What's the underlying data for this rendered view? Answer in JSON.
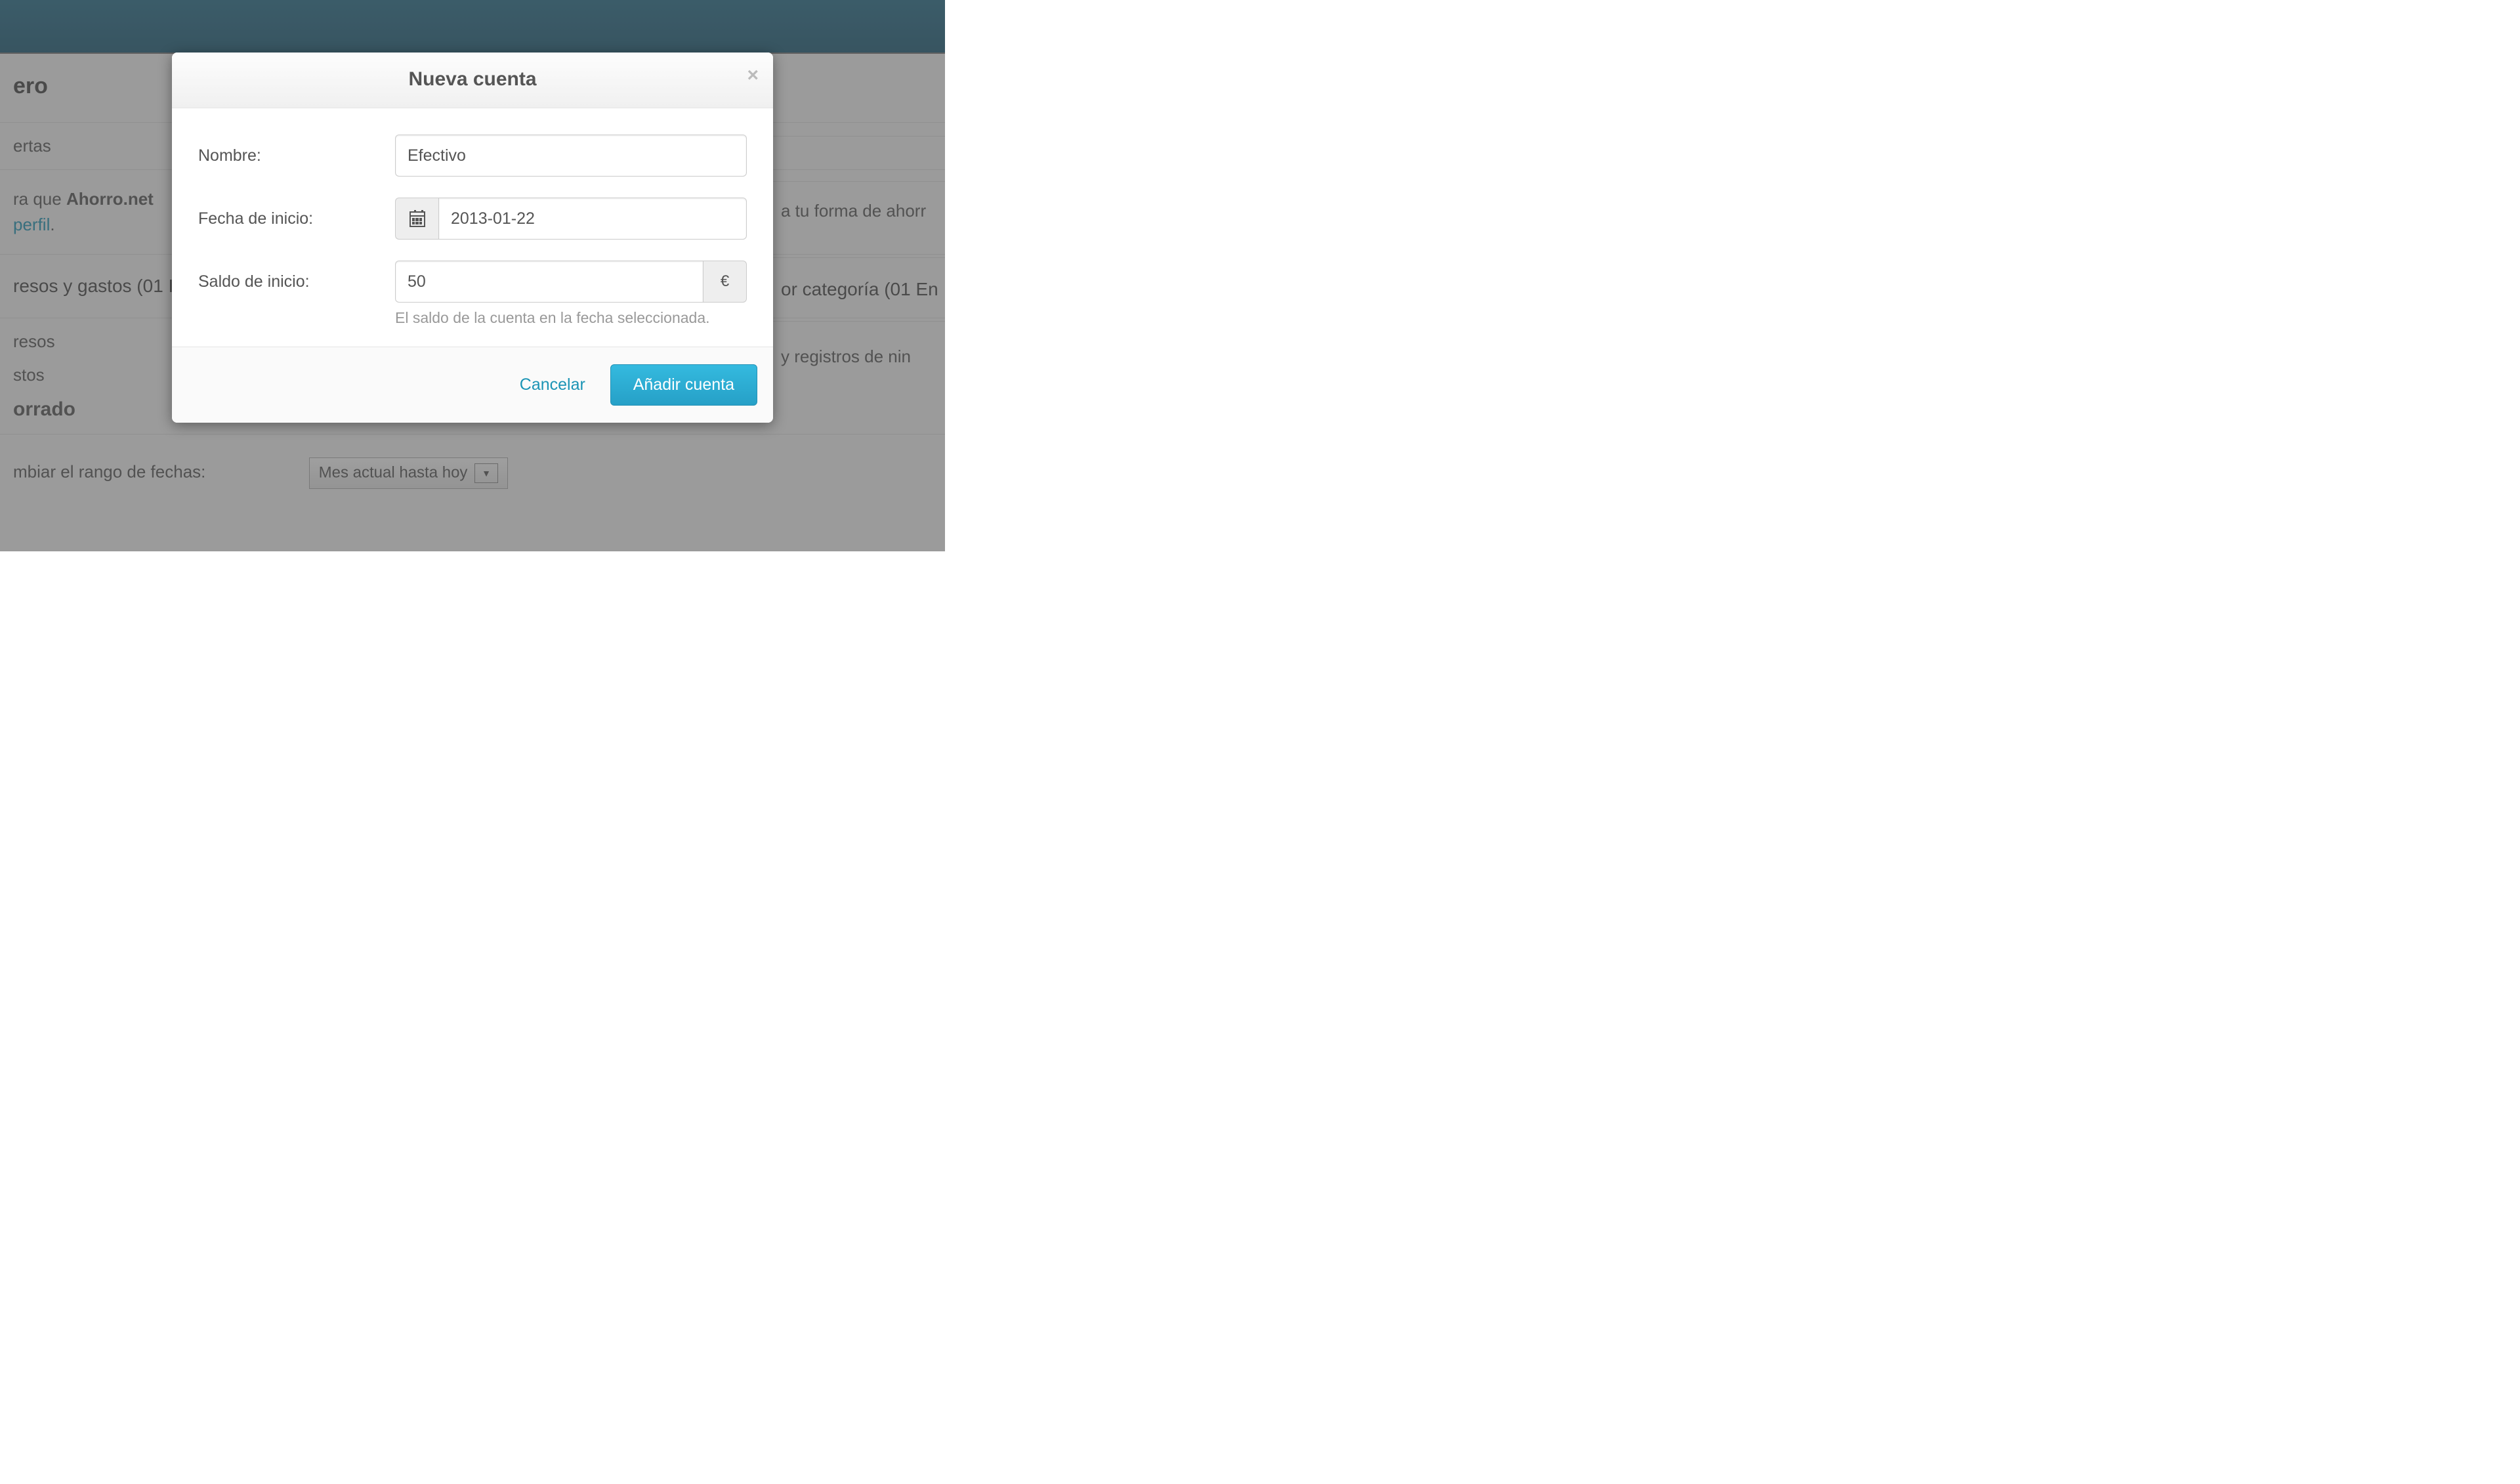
{
  "modal": {
    "title": "Nueva cuenta",
    "close": "×",
    "fields": {
      "name": {
        "label": "Nombre:",
        "value": "Efectivo"
      },
      "start_date": {
        "label": "Fecha de inicio:",
        "value": "2013-01-22"
      },
      "start_balance": {
        "label": "Saldo de inicio:",
        "value": "50",
        "currency": "€",
        "help": "El saldo de la cuenta en la fecha seleccionada."
      }
    },
    "actions": {
      "cancel": "Cancelar",
      "submit": "Añadir cuenta"
    }
  },
  "background": {
    "page_title_fragment": "ero",
    "sidebar_item_1": "ertas",
    "intro_line1_prefix": "ra que ",
    "intro_brand": "Ahorro.net",
    "intro_line2_link": "perfil",
    "intro_line2_dot": ".",
    "intro_right_fragment": "a tu forma de ahorr",
    "section_left": "resos y gastos (01 I",
    "section_right": "or categoría (01 En",
    "row_resos": "resos",
    "row_registros_right": "y registros de nin",
    "row_stos": "stos",
    "row_orrado": "orrado",
    "range_label": "mbiar el rango de fechas:",
    "range_value": "Mes actual hasta hoy"
  }
}
